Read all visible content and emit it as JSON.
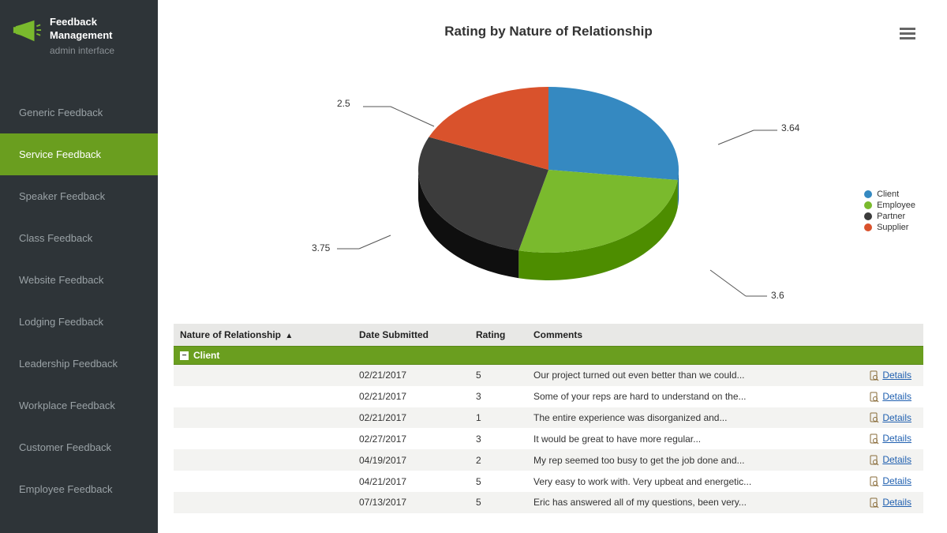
{
  "app": {
    "title1": "Feedback",
    "title2": "Management",
    "subtitle": "admin interface"
  },
  "sidebar": {
    "items": [
      {
        "label": "Generic Feedback"
      },
      {
        "label": "Service Feedback"
      },
      {
        "label": "Speaker Feedback"
      },
      {
        "label": "Class Feedback"
      },
      {
        "label": "Website Feedback"
      },
      {
        "label": "Lodging Feedback"
      },
      {
        "label": "Leadership Feedback"
      },
      {
        "label": "Workplace Feedback"
      },
      {
        "label": "Customer Feedback"
      },
      {
        "label": "Employee Feedback"
      }
    ],
    "active_index": 1
  },
  "chart_data": {
    "type": "pie",
    "title": "Rating by Nature of Relationship",
    "series": [
      {
        "name": "Client",
        "value": 3.64,
        "color": "#3589c1"
      },
      {
        "name": "Employee",
        "value": 3.6,
        "color": "#7aba2d"
      },
      {
        "name": "Partner",
        "value": 3.75,
        "color": "#3c3c3c"
      },
      {
        "name": "Supplier",
        "value": 2.5,
        "color": "#d9522c"
      }
    ],
    "legend_position": "right"
  },
  "table": {
    "headers": {
      "nature": "Nature of Relationship",
      "date": "Date Submitted",
      "rating": "Rating",
      "comments": "Comments"
    },
    "sort_column": "nature",
    "sort_dir": "asc",
    "group": "Client",
    "details_label": "Details",
    "rows": [
      {
        "date": "02/21/2017",
        "rating": "5",
        "comments": "Our project turned out even better than we could..."
      },
      {
        "date": "02/21/2017",
        "rating": "3",
        "comments": "Some of your reps are hard to understand on the..."
      },
      {
        "date": "02/21/2017",
        "rating": "1",
        "comments": "The entire experience was disorganized and..."
      },
      {
        "date": "02/27/2017",
        "rating": "3",
        "comments": "It would be great to have more regular..."
      },
      {
        "date": "04/19/2017",
        "rating": "2",
        "comments": "My rep seemed too busy to get the job done and..."
      },
      {
        "date": "04/21/2017",
        "rating": "5",
        "comments": "Very easy to work with. Very upbeat and energetic..."
      },
      {
        "date": "07/13/2017",
        "rating": "5",
        "comments": "Eric has answered all of my questions, been very..."
      }
    ]
  },
  "colors": {
    "accent": "#6a9e1f",
    "sidebar_bg": "#2e3438",
    "link": "#2060b0"
  }
}
